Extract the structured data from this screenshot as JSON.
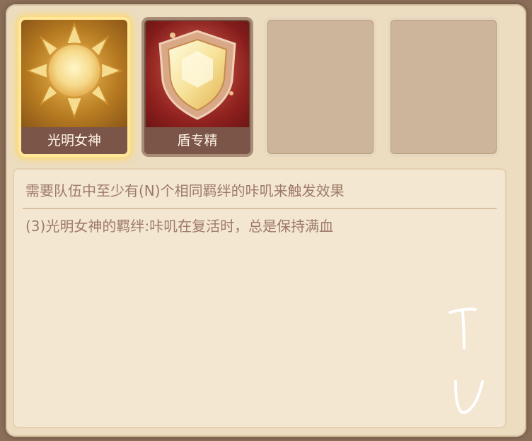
{
  "bonds": [
    {
      "name": "光明女神",
      "icon": "sun-icon",
      "selected": true
    },
    {
      "name": "盾专精",
      "icon": "shield-icon",
      "selected": false
    },
    {
      "name": "",
      "icon": "",
      "empty": true
    },
    {
      "name": "",
      "icon": "",
      "empty": true
    }
  ],
  "description": {
    "title": "需要队伍中至少有(N)个相同羁绊的咔叽来触发效果",
    "lines": [
      "(3)光明女神的羁绊:咔叽在复活时，总是保持满血"
    ]
  },
  "colors": {
    "panel_bg": "#ecdcc0",
    "desc_text": "#9d7a67",
    "label_bg": "#7b5547",
    "selected_glow": "#ffd96a"
  }
}
